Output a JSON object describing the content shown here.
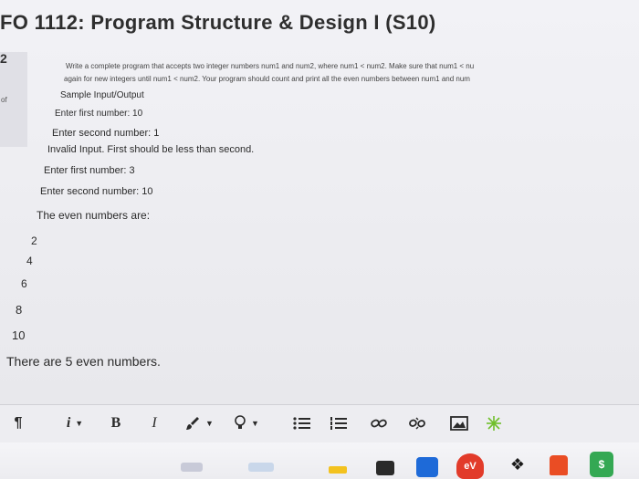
{
  "page": {
    "title": "FO 1112: Program Structure & Design I (S10)"
  },
  "sidebar": {
    "question_number": "2",
    "of_label": "of"
  },
  "question": {
    "prompt_line_1": "Write a complete program that accepts two integer numbers num1 and num2, where num1 < num2. Make sure that num1 < nu",
    "prompt_line_2": "again for new integers until num1 < num2. Your program should count and print all the even numbers between num1 and num",
    "sample_heading": "Sample Input/Output",
    "lines": [
      "Enter first number: 10",
      "Enter second number: 1",
      "Invalid Input. First should be less than second.",
      "Enter first number: 3",
      "Enter second number: 10",
      "The even numbers are:"
    ],
    "even_numbers": [
      "2",
      "4",
      "6",
      "8",
      "10"
    ],
    "summary": "There are 5 even numbers."
  },
  "toolbar": {
    "paragraph_label": "¶",
    "info_label": "i",
    "bold_label": "B",
    "italic_label": "I",
    "icons": [
      "paragraph-icon",
      "info-icon",
      "bold-icon",
      "italic-icon",
      "brush-icon",
      "lightbulb-icon",
      "bullet-list-icon",
      "numbered-list-icon",
      "link-icon",
      "unlink-icon",
      "image-icon",
      "sparkle-icon"
    ]
  },
  "taskbar": {
    "icons": [
      "app-icon-1",
      "app-icon-2",
      "folder-icon",
      "lock-icon",
      "mail-icon",
      "brand-icon",
      "dropbox-icon",
      "office-icon",
      "cash-icon"
    ],
    "labels": [
      "eV",
      "$"
    ],
    "colors": {
      "accent_red": "#e23b2a",
      "accent_blue": "#1e6ad8",
      "accent_green": "#34a853",
      "folder_yellow": "#f3c21f"
    }
  }
}
